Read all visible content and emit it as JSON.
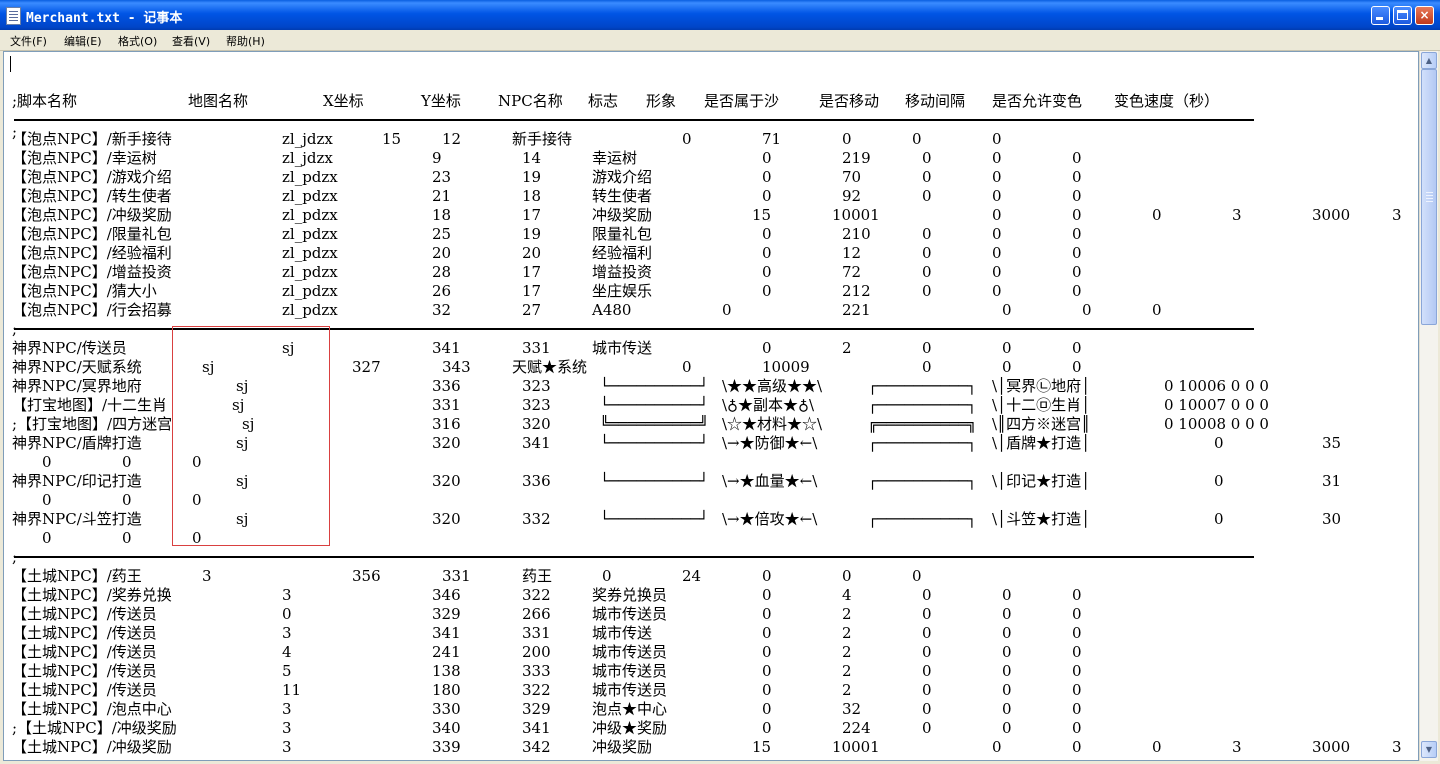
{
  "window": {
    "title": "Merchant.txt - 记事本",
    "minimize_glyph": "_",
    "maximize_glyph": "□",
    "close_glyph": "×"
  },
  "menu": [
    {
      "label": "文件(F)"
    },
    {
      "label": "编辑(E)"
    },
    {
      "label": "格式(O)"
    },
    {
      "label": "查看(V)"
    },
    {
      "label": "帮助(H)"
    }
  ],
  "scrollbar": {
    "up_glyph": "▲",
    "down_glyph": "▼"
  },
  "colors": {
    "title_bar": "#0055e5",
    "close_button": "#c0391c",
    "highlight_box": "#d94040",
    "editor_bg": "#ffffff"
  },
  "lines": [
    {
      "cells": [
        [
          ";脚本名称",
          8
        ],
        [
          "地图名称",
          184
        ],
        [
          "X坐标",
          319
        ],
        [
          "Y坐标",
          417
        ],
        [
          "NPC名称",
          494
        ],
        [
          "标志",
          584
        ],
        [
          "形象",
          642
        ],
        [
          "是否属于沙",
          700
        ],
        [
          "是否移动",
          815
        ],
        [
          "移动间隔",
          901
        ],
        [
          "是否允许变色",
          988
        ],
        [
          "变色速度（秒）",
          1110
        ]
      ]
    },
    {
      "cells": [
        [
          ";",
          8
        ]
      ]
    },
    {
      "cells": [
        [
          "【泡点NPC】/新手接待",
          8
        ],
        [
          "zl_jdzx",
          278
        ],
        [
          "15",
          378
        ],
        [
          "12",
          438
        ],
        [
          "新手接待",
          508
        ],
        [
          "0",
          678
        ],
        [
          "71",
          758
        ],
        [
          "0",
          838
        ],
        [
          "0",
          908
        ],
        [
          "0",
          988
        ]
      ]
    },
    {
      "cells": [
        [
          "【泡点NPC】/幸运树",
          8
        ],
        [
          "zl_jdzx",
          278
        ],
        [
          "9",
          428
        ],
        [
          "14",
          518
        ],
        [
          "幸运树",
          588
        ],
        [
          "0",
          758
        ],
        [
          "219",
          838
        ],
        [
          "0",
          918
        ],
        [
          "0",
          988
        ],
        [
          "0",
          1068
        ]
      ]
    },
    {
      "cells": [
        [
          "【泡点NPC】/游戏介绍",
          8
        ],
        [
          "zl_pdzx",
          278
        ],
        [
          "23",
          428
        ],
        [
          "19",
          518
        ],
        [
          "游戏介绍",
          588
        ],
        [
          "0",
          758
        ],
        [
          "70",
          838
        ],
        [
          "0",
          918
        ],
        [
          "0",
          988
        ],
        [
          "0",
          1068
        ]
      ]
    },
    {
      "cells": [
        [
          "【泡点NPC】/转生使者",
          8
        ],
        [
          "zl_pdzx",
          278
        ],
        [
          "21",
          428
        ],
        [
          "18",
          518
        ],
        [
          "转生使者",
          588
        ],
        [
          "0",
          758
        ],
        [
          "92",
          838
        ],
        [
          "0",
          918
        ],
        [
          "0",
          988
        ],
        [
          "0",
          1068
        ]
      ]
    },
    {
      "cells": [
        [
          "【泡点NPC】/冲级奖励",
          8
        ],
        [
          "zl_pdzx",
          278
        ],
        [
          "18",
          428
        ],
        [
          "17",
          518
        ],
        [
          "冲级奖励",
          588
        ],
        [
          "15",
          748
        ],
        [
          "10001",
          828
        ],
        [
          "0",
          988
        ],
        [
          "0",
          1068
        ],
        [
          "0",
          1148
        ],
        [
          "3",
          1228
        ],
        [
          "3000",
          1308
        ],
        [
          "3",
          1388
        ]
      ]
    },
    {
      "cells": [
        [
          "【泡点NPC】/限量礼包",
          8
        ],
        [
          "zl_pdzx",
          278
        ],
        [
          "25",
          428
        ],
        [
          "19",
          518
        ],
        [
          "限量礼包",
          588
        ],
        [
          "0",
          758
        ],
        [
          "210",
          838
        ],
        [
          "0",
          918
        ],
        [
          "0",
          988
        ],
        [
          "0",
          1068
        ]
      ]
    },
    {
      "cells": [
        [
          "【泡点NPC】/经验福利",
          8
        ],
        [
          "zl_pdzx",
          278
        ],
        [
          "20",
          428
        ],
        [
          "20",
          518
        ],
        [
          "经验福利",
          588
        ],
        [
          "0",
          758
        ],
        [
          "12",
          838
        ],
        [
          "0",
          918
        ],
        [
          "0",
          988
        ],
        [
          "0",
          1068
        ]
      ]
    },
    {
      "cells": [
        [
          "【泡点NPC】/增益投资",
          8
        ],
        [
          "zl_pdzx",
          278
        ],
        [
          "28",
          428
        ],
        [
          "17",
          518
        ],
        [
          "增益投资",
          588
        ],
        [
          "0",
          758
        ],
        [
          "72",
          838
        ],
        [
          "0",
          918
        ],
        [
          "0",
          988
        ],
        [
          "0",
          1068
        ]
      ]
    },
    {
      "cells": [
        [
          "【泡点NPC】/猜大小",
          8
        ],
        [
          "zl_pdzx",
          278
        ],
        [
          "26",
          428
        ],
        [
          "17",
          518
        ],
        [
          "坐庄娱乐",
          588
        ],
        [
          "0",
          758
        ],
        [
          "212",
          838
        ],
        [
          "0",
          918
        ],
        [
          "0",
          988
        ],
        [
          "0",
          1068
        ]
      ]
    },
    {
      "cells": [
        [
          "【泡点NPC】/行会招募",
          8
        ],
        [
          "zl_pdzx",
          278
        ],
        [
          "32",
          428
        ],
        [
          "27",
          518
        ],
        [
          "A480",
          588
        ],
        [
          "0",
          718
        ],
        [
          "221",
          838
        ],
        [
          "0",
          998
        ],
        [
          "0",
          1078
        ],
        [
          "0",
          1148
        ]
      ]
    },
    {
      "cells": [
        [
          ";",
          8
        ]
      ]
    },
    {
      "cells": [
        [
          "神界NPC/传送员",
          8
        ],
        [
          "sj",
          278
        ],
        [
          "341",
          428
        ],
        [
          "331",
          518
        ],
        [
          "城市传送",
          588
        ],
        [
          "0",
          758
        ],
        [
          "2",
          838
        ],
        [
          "0",
          918
        ],
        [
          "0",
          998
        ],
        [
          "0",
          1068
        ]
      ]
    },
    {
      "cells": [
        [
          "神界NPC/天赋系统",
          8
        ],
        [
          "sj",
          198
        ],
        [
          "327",
          348
        ],
        [
          "343",
          438
        ],
        [
          "天赋★系统",
          508
        ],
        [
          "0",
          678
        ],
        [
          "10009",
          758
        ],
        [
          "0",
          918
        ],
        [
          "0",
          998
        ],
        [
          "0",
          1068
        ]
      ]
    },
    {
      "cells": [
        [
          "神界NPC/冥界地府",
          8
        ],
        [
          "sj",
          232
        ],
        [
          "336",
          428
        ],
        [
          "323",
          518
        ],
        [
          "└──────────┘",
          596
        ],
        [
          "\\★★高级★★\\",
          718
        ],
        [
          "┌──────────┐",
          864
        ],
        [
          "\\│冥界㉡地府│",
          988
        ],
        [
          "0 10006 0 0 0",
          1160
        ]
      ]
    },
    {
      "cells": [
        [
          "【打宝地图】/十二生肖",
          8
        ],
        [
          "sj",
          228
        ],
        [
          "331",
          428
        ],
        [
          "323",
          518
        ],
        [
          "└──────────┘",
          596
        ],
        [
          "\\♁★副本★♁\\",
          718
        ],
        [
          "┌──────────┐",
          864
        ],
        [
          "\\│十二㉤生肖│",
          988
        ],
        [
          "0 10007 0 0 0",
          1160
        ]
      ]
    },
    {
      "cells": [
        [
          ";【打宝地图】/四方迷宫",
          8
        ],
        [
          "sj",
          238
        ],
        [
          "316",
          428
        ],
        [
          "320",
          518
        ],
        [
          "╚══════════╝",
          596
        ],
        [
          "\\☆★材料★☆\\",
          718
        ],
        [
          "╔══════════╗",
          864
        ],
        [
          "\\║四方※迷宫║",
          988
        ],
        [
          "0 10008 0 0 0",
          1160
        ]
      ]
    },
    {
      "cells": [
        [
          "神界NPC/盾牌打造",
          8
        ],
        [
          "sj",
          232
        ],
        [
          "320",
          428
        ],
        [
          "341",
          518
        ],
        [
          "└──────────┘",
          596
        ],
        [
          "\\→★防御★←\\",
          718
        ],
        [
          "┌──────────┐",
          864
        ],
        [
          "\\│盾牌★打造│",
          988
        ],
        [
          "0",
          1210
        ],
        [
          "35",
          1318
        ]
      ]
    },
    {
      "cells": [
        [
          "0",
          38
        ],
        [
          "0",
          118
        ],
        [
          "0",
          188
        ]
      ]
    },
    {
      "cells": [
        [
          "神界NPC/印记打造",
          8
        ],
        [
          "sj",
          232
        ],
        [
          "320",
          428
        ],
        [
          "336",
          518
        ],
        [
          "└──────────┘",
          596
        ],
        [
          "\\→★血量★←\\",
          718
        ],
        [
          "┌──────────┐",
          864
        ],
        [
          "\\│印记★打造│",
          988
        ],
        [
          "0",
          1210
        ],
        [
          "31",
          1318
        ]
      ]
    },
    {
      "cells": [
        [
          "0",
          38
        ],
        [
          "0",
          118
        ],
        [
          "0",
          188
        ]
      ]
    },
    {
      "cells": [
        [
          "神界NPC/斗笠打造",
          8
        ],
        [
          "sj",
          232
        ],
        [
          "320",
          428
        ],
        [
          "332",
          518
        ],
        [
          "└──────────┘",
          596
        ],
        [
          "\\→★倍攻★←\\",
          718
        ],
        [
          "┌──────────┐",
          864
        ],
        [
          "\\│斗笠★打造│",
          988
        ],
        [
          "0",
          1210
        ],
        [
          "30",
          1318
        ]
      ]
    },
    {
      "cells": [
        [
          "0",
          38
        ],
        [
          "0",
          118
        ],
        [
          "0",
          188
        ]
      ]
    },
    {
      "cells": [
        [
          ";",
          8
        ]
      ]
    },
    {
      "cells": [
        [
          "【土城NPC】/药王",
          8
        ],
        [
          "3",
          198
        ],
        [
          "356",
          348
        ],
        [
          "331",
          438
        ],
        [
          "药王",
          518
        ],
        [
          "0",
          598
        ],
        [
          "24",
          678
        ],
        [
          "0",
          758
        ],
        [
          "0",
          838
        ],
        [
          "0",
          908
        ]
      ]
    },
    {
      "cells": [
        [
          "【土城NPC】/奖券兑换",
          8
        ],
        [
          "3",
          278
        ],
        [
          "346",
          428
        ],
        [
          "322",
          518
        ],
        [
          "奖券兑换员",
          588
        ],
        [
          "0",
          758
        ],
        [
          "4",
          838
        ],
        [
          "0",
          918
        ],
        [
          "0",
          998
        ],
        [
          "0",
          1068
        ]
      ]
    },
    {
      "cells": [
        [
          "【土城NPC】/传送员",
          8
        ],
        [
          "0",
          278
        ],
        [
          "329",
          428
        ],
        [
          "266",
          518
        ],
        [
          "城市传送员",
          588
        ],
        [
          "0",
          758
        ],
        [
          "2",
          838
        ],
        [
          "0",
          918
        ],
        [
          "0",
          998
        ],
        [
          "0",
          1068
        ]
      ]
    },
    {
      "cells": [
        [
          "【土城NPC】/传送员",
          8
        ],
        [
          "3",
          278
        ],
        [
          "341",
          428
        ],
        [
          "331",
          518
        ],
        [
          "城市传送",
          588
        ],
        [
          "0",
          758
        ],
        [
          "2",
          838
        ],
        [
          "0",
          918
        ],
        [
          "0",
          998
        ],
        [
          "0",
          1068
        ]
      ]
    },
    {
      "cells": [
        [
          "【土城NPC】/传送员",
          8
        ],
        [
          "4",
          278
        ],
        [
          "241",
          428
        ],
        [
          "200",
          518
        ],
        [
          "城市传送员",
          588
        ],
        [
          "0",
          758
        ],
        [
          "2",
          838
        ],
        [
          "0",
          918
        ],
        [
          "0",
          998
        ],
        [
          "0",
          1068
        ]
      ]
    },
    {
      "cells": [
        [
          "【土城NPC】/传送员",
          8
        ],
        [
          "5",
          278
        ],
        [
          "138",
          428
        ],
        [
          "333",
          518
        ],
        [
          "城市传送员",
          588
        ],
        [
          "0",
          758
        ],
        [
          "2",
          838
        ],
        [
          "0",
          918
        ],
        [
          "0",
          998
        ],
        [
          "0",
          1068
        ]
      ]
    },
    {
      "cells": [
        [
          "【土城NPC】/传送员",
          8
        ],
        [
          "11",
          278
        ],
        [
          "180",
          428
        ],
        [
          "322",
          518
        ],
        [
          "城市传送员",
          588
        ],
        [
          "0",
          758
        ],
        [
          "2",
          838
        ],
        [
          "0",
          918
        ],
        [
          "0",
          998
        ],
        [
          "0",
          1068
        ]
      ]
    },
    {
      "cells": [
        [
          "【土城NPC】/泡点中心",
          8
        ],
        [
          "3",
          278
        ],
        [
          "330",
          428
        ],
        [
          "329",
          518
        ],
        [
          "泡点★中心",
          588
        ],
        [
          "0",
          758
        ],
        [
          "32",
          838
        ],
        [
          "0",
          918
        ],
        [
          "0",
          998
        ],
        [
          "0",
          1068
        ]
      ]
    },
    {
      "cells": [
        [
          ";【土城NPC】/冲级奖励",
          8
        ],
        [
          "3",
          278
        ],
        [
          "340",
          428
        ],
        [
          "341",
          518
        ],
        [
          "冲级★奖励",
          588
        ],
        [
          "0",
          758
        ],
        [
          "224",
          838
        ],
        [
          "0",
          918
        ],
        [
          "0",
          998
        ],
        [
          "0",
          1068
        ]
      ]
    },
    {
      "cells": [
        [
          "【土城NPC】/冲级奖励",
          8
        ],
        [
          "3",
          278
        ],
        [
          "339",
          428
        ],
        [
          "342",
          518
        ],
        [
          "冲级奖励",
          588
        ],
        [
          "15",
          748
        ],
        [
          "10001",
          828
        ],
        [
          "0",
          988
        ],
        [
          "0",
          1068
        ],
        [
          "0",
          1148
        ],
        [
          "3",
          1228
        ],
        [
          "3000",
          1308
        ],
        [
          "3",
          1388
        ]
      ]
    }
  ]
}
